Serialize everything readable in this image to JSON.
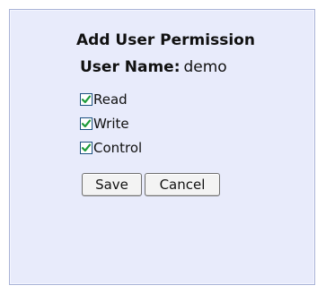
{
  "dialog": {
    "title": "Add User Permission",
    "user_name_label": "User Name:",
    "user_name_value": "demo"
  },
  "permissions": [
    {
      "label": "Read",
      "checked": true
    },
    {
      "label": "Write",
      "checked": true
    },
    {
      "label": "Control",
      "checked": true
    }
  ],
  "buttons": {
    "save_label": "Save",
    "cancel_label": "Cancel"
  },
  "colors": {
    "panel_background": "#e8ebfb",
    "panel_border": "#a9b3d6",
    "checkmark": "#1f9c3b",
    "checkbox_border": "#1c5180"
  }
}
